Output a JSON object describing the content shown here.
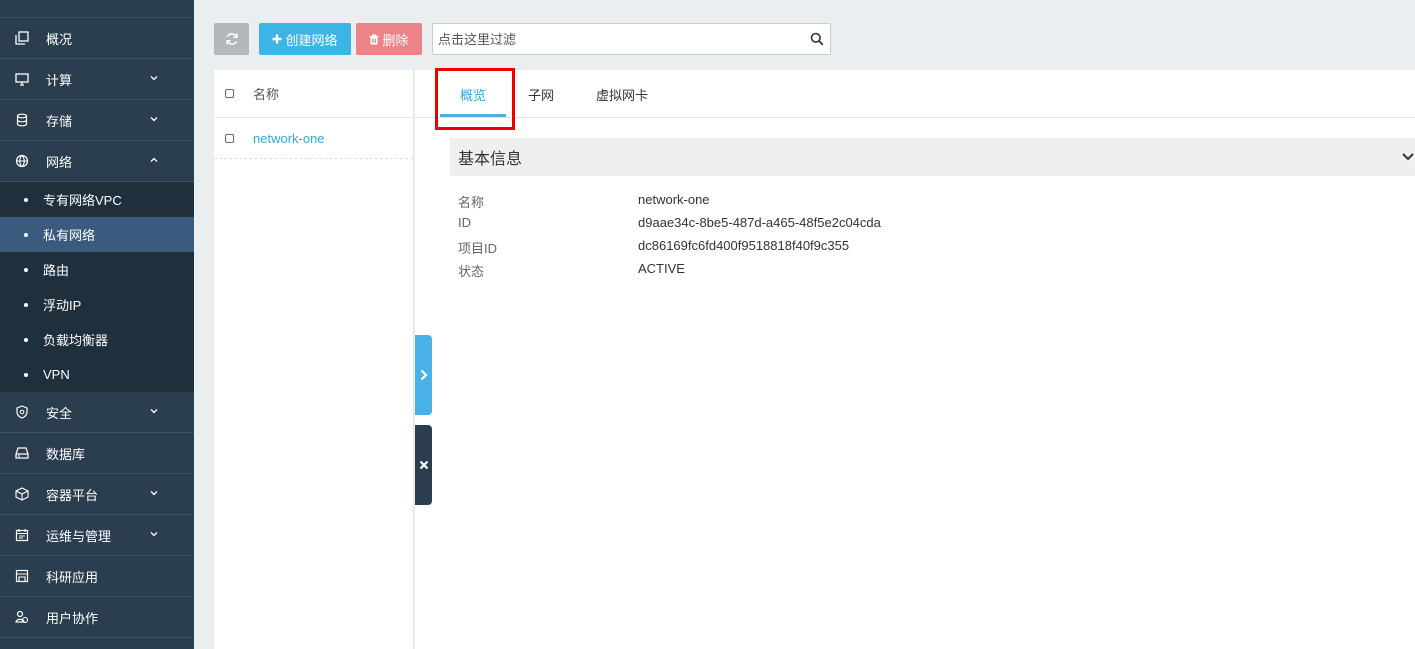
{
  "sidebar": {
    "items": [
      {
        "label": "概况",
        "icon": "overview-icon"
      },
      {
        "label": "计算",
        "icon": "monitor-icon"
      },
      {
        "label": "存储",
        "icon": "database-icon"
      },
      {
        "label": "网络",
        "icon": "network-icon"
      },
      {
        "label": "安全",
        "icon": "shield-icon"
      },
      {
        "label": "数据库",
        "icon": "db-drive-icon"
      },
      {
        "label": "容器平台",
        "icon": "cube-icon"
      },
      {
        "label": "运维与管理",
        "icon": "calendar-icon"
      },
      {
        "label": "科研应用",
        "icon": "store-icon"
      },
      {
        "label": "用户协作",
        "icon": "users-icon"
      }
    ],
    "network_sub": [
      "专有网络VPC",
      "私有网络",
      "路由",
      "浮动IP",
      "负载均衡器",
      "VPN"
    ]
  },
  "toolbar": {
    "create_label": "创建网络",
    "delete_label": "删除",
    "search_placeholder": "点击这里过滤"
  },
  "list": {
    "header": "名称",
    "rows": [
      "network-one"
    ]
  },
  "detail": {
    "tabs": [
      "概览",
      "子网",
      "虚拟网卡"
    ],
    "section_title": "基本信息",
    "info": [
      {
        "key": "名称",
        "value": "network-one"
      },
      {
        "key": "ID",
        "value": "d9aae34c-8be5-487d-a465-48f5e2c04cda"
      },
      {
        "key": "项目ID",
        "value": "dc86169fc6fd400f9518818f40f9c355"
      },
      {
        "key": "状态",
        "value": "ACTIVE"
      }
    ]
  },
  "colors": {
    "sidebar": "#2b3e4f",
    "accent": "#3bb4e8",
    "danger": "#eb8387",
    "highlight": "#e00000"
  }
}
